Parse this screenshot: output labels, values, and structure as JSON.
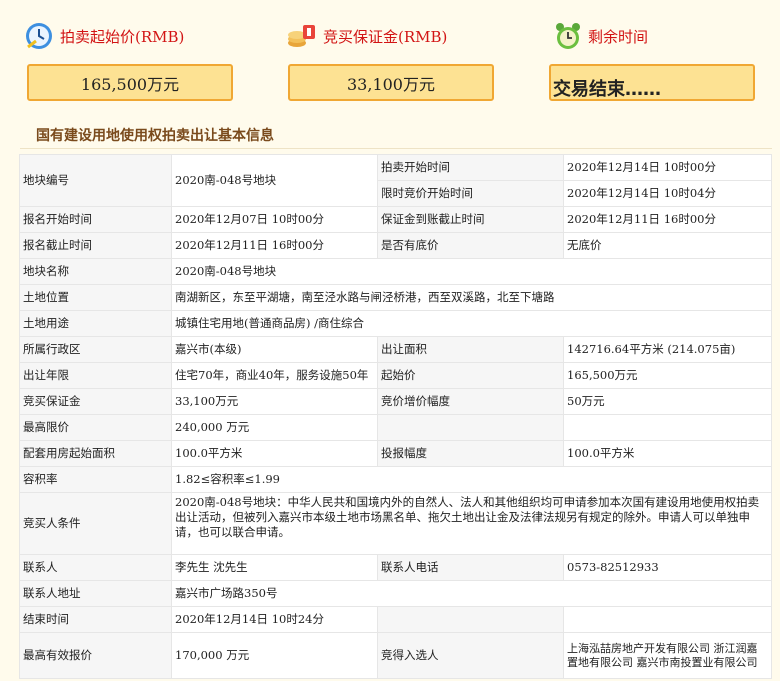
{
  "header": {
    "start_price_label": "拍卖起始价(RMB)",
    "start_price_value": "165,500万元",
    "deposit_label": "竞买保证金(RMB)",
    "deposit_value": "33,100万元",
    "remaining_label": "剩余时间",
    "remaining_value": "交易结束……"
  },
  "section_title": "国有建设用地使用权拍卖出让基本信息",
  "rows": {
    "lot_no_label": "地块编号",
    "lot_no": "2020南-048号地块",
    "auction_start_label": "拍卖开始时间",
    "auction_start": "2020年12月14日 10时00分",
    "timed_start_label": "限时竞价开始时间",
    "timed_start": "2020年12月14日 10时04分",
    "reg_start_label": "报名开始时间",
    "reg_start": "2020年12月07日 10时00分",
    "deposit_deadline_label": "保证金到账截止时间",
    "deposit_deadline": "2020年12月11日 16时00分",
    "reg_end_label": "报名截止时间",
    "reg_end": "2020年12月11日 16时00分",
    "reserve_label": "是否有底价",
    "reserve": "无底价",
    "name_label": "地块名称",
    "name": "2020南-048号地块",
    "location_label": "土地位置",
    "location": "南湖新区，东至平湖塘，南至泾水路与闸泾桥港，西至双溪路，北至下塘路",
    "usage_label": "土地用途",
    "usage": "城镇住宅用地(普通商品房) /商住综合",
    "district_label": "所属行政区",
    "district": "嘉兴市(本级)",
    "area_label": "出让面积",
    "area": "142716.64平方米 (214.075亩)",
    "term_label": "出让年限",
    "term": "住宅70年，商业40年，服务设施50年",
    "start_price_label": "起始价",
    "start_price": "165,500万元",
    "deposit_label": "竞买保证金",
    "deposit": "33,100万元",
    "increment_label": "竞价增价幅度",
    "increment": "50万元",
    "max_price_label": "最高限价",
    "max_price": "240,000 万元",
    "housing_area_label": "配套用房起始面积",
    "housing_area": "100.0平方米",
    "housing_inc_label": "投报幅度",
    "housing_inc": "100.0平方米",
    "far_label": "容积率",
    "far": "1.82≤容积率≤1.99",
    "conditions_label": "竞买人条件",
    "conditions": "2020南-048号地块：中华人民共和国境内外的自然人、法人和其他组织均可申请参加本次国有建设用地使用权拍卖出让活动，但被列入嘉兴市本级土地市场黑名单、拖欠土地出让金及法律法规另有规定的除外。申请人可以单独申请，也可以联合申请。",
    "contact_label": "联系人",
    "contact": "李先生 沈先生",
    "phone_label": "联系人电话",
    "phone": "0573-82512933",
    "address_label": "联系人地址",
    "address": "嘉兴市广场路350号",
    "end_time_label": "结束时间",
    "end_time": "2020年12月14日 10时24分",
    "top_bid_label": "最高有效报价",
    "top_bid": "170,000 万元",
    "winner_label": "竞得入选人",
    "winner": "上海泓喆房地产开发有限公司 浙江润嘉置地有限公司 嘉兴市南投置业有限公司"
  }
}
